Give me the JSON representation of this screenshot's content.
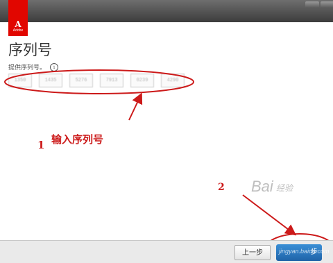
{
  "brand": {
    "logo_word": "Adobe",
    "logo_color": "#e10600"
  },
  "page": {
    "title": "序列号",
    "instruction": "提供序列号。",
    "info_icon": "info-icon"
  },
  "serial_fields": [
    "1350",
    "1435",
    "5276",
    "7913",
    "0239",
    "4290"
  ],
  "annotations": {
    "step1_number": "1",
    "step1_text": "输入序列号",
    "step2_number": "2",
    "color": "#cc1a1a"
  },
  "footer": {
    "back_label": "上一步",
    "next_label": "步"
  },
  "watermark": {
    "text1": "Bai",
    "text2": "经验",
    "text3": "jingyan.baidu.com"
  }
}
